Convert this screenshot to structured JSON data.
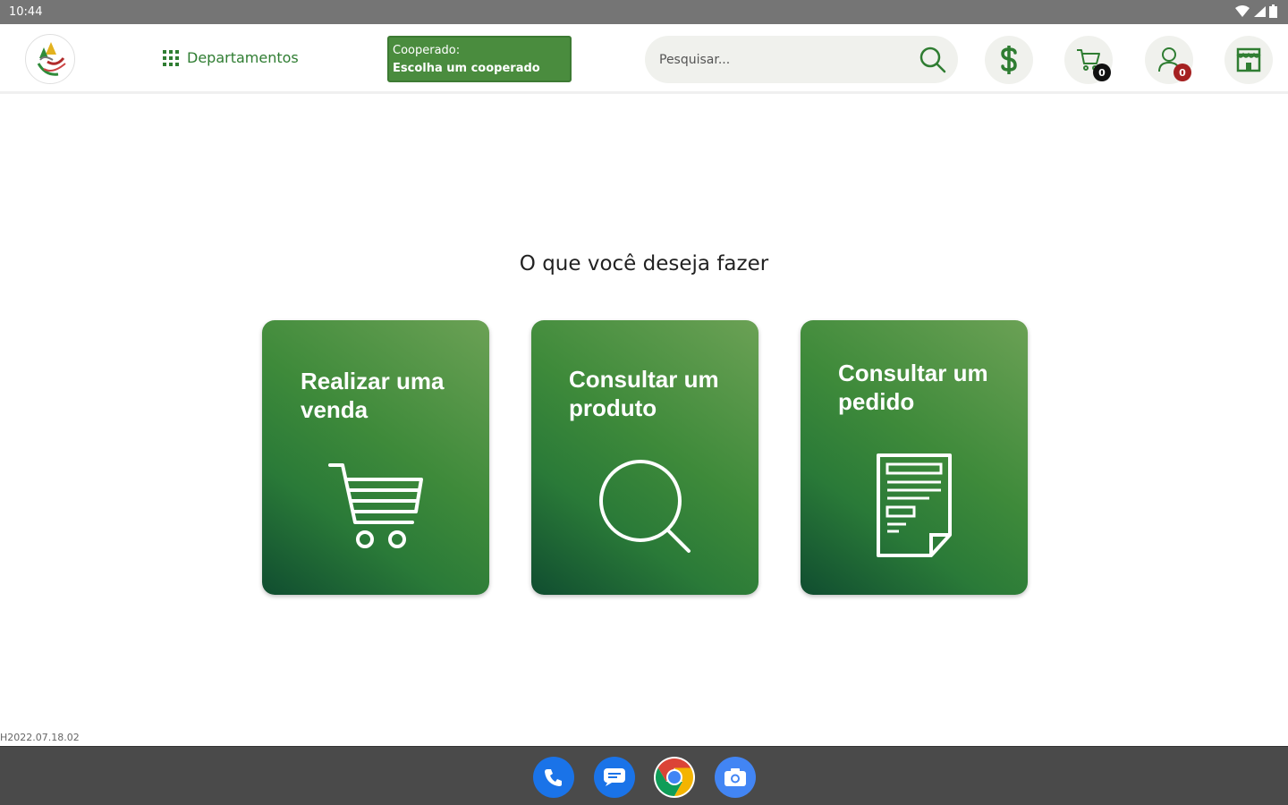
{
  "status": {
    "time": "10:44"
  },
  "header": {
    "departments_label": "Departamentos",
    "cooperado_label": "Cooperado:",
    "cooperado_value": "Escolha um cooperado",
    "search_placeholder": "Pesquisar...",
    "cart_count": "0",
    "user_badge": "0"
  },
  "main": {
    "title": "O que você deseja fazer",
    "cards": [
      {
        "label": "Realizar uma venda",
        "icon": "shopping-cart-icon"
      },
      {
        "label": "Consultar um produto",
        "icon": "search-icon"
      },
      {
        "label": "Consultar um pedido",
        "icon": "document-icon"
      }
    ]
  },
  "footer": {
    "version": "H2022.07.18.02"
  },
  "colors": {
    "brand_green": "#2f7d32",
    "card_dark": "#104d30",
    "card_light": "#6ba155",
    "badge_red": "#a52121"
  }
}
